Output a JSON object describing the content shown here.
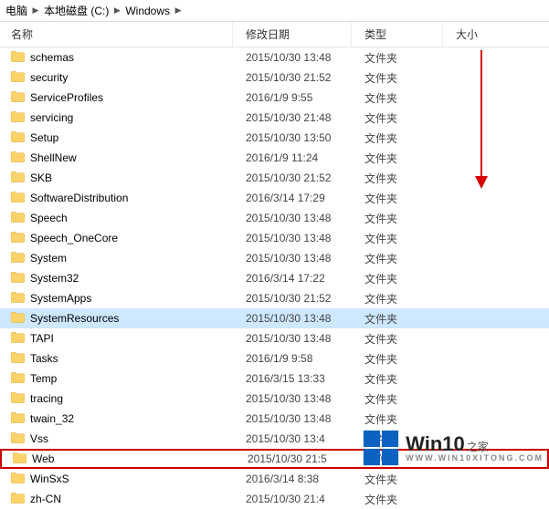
{
  "breadcrumb": {
    "seg1": "电脑",
    "seg2": "本地磁盘 (C:)",
    "seg3": "Windows"
  },
  "columns": {
    "name": "名称",
    "date": "修改日期",
    "type": "类型",
    "size": "大小"
  },
  "type_folder": "文件夹",
  "rows": [
    {
      "name": "schemas",
      "date": "2015/10/30 13:48"
    },
    {
      "name": "security",
      "date": "2015/10/30 21:52"
    },
    {
      "name": "ServiceProfiles",
      "date": "2016/1/9 9:55"
    },
    {
      "name": "servicing",
      "date": "2015/10/30 21:48"
    },
    {
      "name": "Setup",
      "date": "2015/10/30 13:50"
    },
    {
      "name": "ShellNew",
      "date": "2016/1/9 11:24"
    },
    {
      "name": "SKB",
      "date": "2015/10/30 21:52"
    },
    {
      "name": "SoftwareDistribution",
      "date": "2016/3/14 17:29"
    },
    {
      "name": "Speech",
      "date": "2015/10/30 13:48"
    },
    {
      "name": "Speech_OneCore",
      "date": "2015/10/30 13:48"
    },
    {
      "name": "System",
      "date": "2015/10/30 13:48"
    },
    {
      "name": "System32",
      "date": "2016/3/14 17:22"
    },
    {
      "name": "SystemApps",
      "date": "2015/10/30 21:52"
    },
    {
      "name": "SystemResources",
      "date": "2015/10/30 13:48",
      "selected": true
    },
    {
      "name": "TAPI",
      "date": "2015/10/30 13:48"
    },
    {
      "name": "Tasks",
      "date": "2016/1/9 9:58"
    },
    {
      "name": "Temp",
      "date": "2016/3/15 13:33"
    },
    {
      "name": "tracing",
      "date": "2015/10/30 13:48"
    },
    {
      "name": "twain_32",
      "date": "2015/10/30 13:48"
    },
    {
      "name": "Vss",
      "date": "2015/10/30 13:4"
    },
    {
      "name": "Web",
      "date": "2015/10/30 21:5",
      "highlighted": true
    },
    {
      "name": "WinSxS",
      "date": "2016/3/14 8:38"
    },
    {
      "name": "zh-CN",
      "date": "2015/10/30 21:4"
    }
  ],
  "watermark": {
    "brand": "Win10",
    "suffix": "之家"
  }
}
